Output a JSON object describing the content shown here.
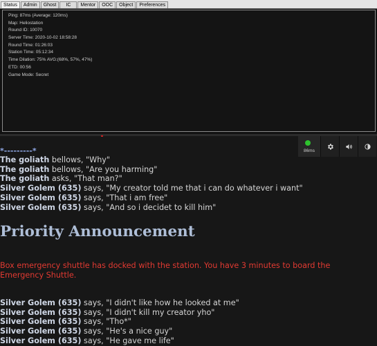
{
  "tabs": [
    "Status",
    "Admin",
    "Ghost",
    "IC",
    "Mentor",
    "OOC",
    "Object",
    "Preferences"
  ],
  "status": [
    "Ping: 87ms (Average: 120ms)",
    "Map: Heliostation",
    "Round ID: 10070",
    "Server Time: 2020-10-02 18:58:28",
    "Round Time: 01:26:03",
    "Station Time: 05:12:34",
    "Time Dilation: 75% AVG:(68%, 57%, 47%)",
    "ETD: 00:56",
    "Game Mode: Secret"
  ],
  "controls": {
    "ping": "86ms",
    "ping_color": "#2ec22e",
    "icons": [
      "gear-icon",
      "volume-icon",
      "contrast-icon"
    ]
  },
  "chat_top": {
    "separator": "*---------*",
    "lines": [
      {
        "speaker": "The goliath",
        "text": " bellows, \"Why\""
      },
      {
        "speaker": "The goliath",
        "text": " bellows, \"Are you harming\""
      },
      {
        "speaker": "The goliath",
        "text": " asks, \"That man?\""
      },
      {
        "speaker": "Silver Golem (635)",
        "text": " says, \"My creator told me that i can do whatever i want\""
      },
      {
        "speaker": "Silver Golem (635)",
        "text": " says, \"That i am free\""
      },
      {
        "speaker": "Silver Golem (635)",
        "text": " says, \"And so i decidet to kill him\""
      }
    ]
  },
  "announcement": {
    "title": "Priority Announcement",
    "body": "Box emergency shuttle has docked with the station. You have 3 minutes to board the Emergency Shuttle.",
    "color": "#e23a32"
  },
  "chat_bottom": {
    "lines": [
      {
        "speaker": "Silver Golem (635)",
        "text": " says, \"I didn't like how he looked at me\""
      },
      {
        "speaker": "Silver Golem (635)",
        "text": " says, \"I didn't kill my creator yho\""
      },
      {
        "speaker": "Silver Golem (635)",
        "text": " says, \"Tho*\""
      },
      {
        "speaker": "Silver Golem (635)",
        "text": " says, \"He's a nice guy\""
      },
      {
        "speaker": "Silver Golem (635)",
        "text": " says, \"He gave me life\""
      }
    ]
  }
}
